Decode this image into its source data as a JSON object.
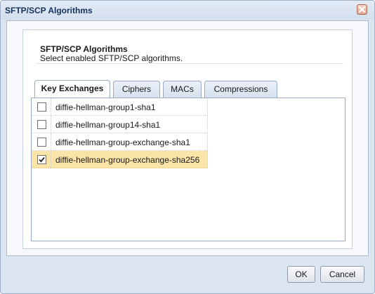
{
  "window": {
    "title": "SFTP/SCP Algorithms"
  },
  "header": {
    "title": "SFTP/SCP Algorithms",
    "description": "Select enabled SFTP/SCP algorithms."
  },
  "tabs": [
    {
      "label": "Key Exchanges",
      "active": true
    },
    {
      "label": "Ciphers",
      "active": false
    },
    {
      "label": "MACs",
      "active": false
    },
    {
      "label": "Compressions",
      "active": false
    }
  ],
  "key_exchanges": [
    {
      "label": "diffie-hellman-group1-sha1",
      "checked": false,
      "selected": false
    },
    {
      "label": "diffie-hellman-group14-sha1",
      "checked": false,
      "selected": false
    },
    {
      "label": "diffie-hellman-group-exchange-sha1",
      "checked": false,
      "selected": false
    },
    {
      "label": "diffie-hellman-group-exchange-sha256",
      "checked": true,
      "selected": true
    }
  ],
  "buttons": {
    "ok": "OK",
    "cancel": "Cancel"
  },
  "colors": {
    "dialog_bg": "#dce6f2",
    "selected_row": "#fbe4a7",
    "title_text": "#15325a"
  }
}
